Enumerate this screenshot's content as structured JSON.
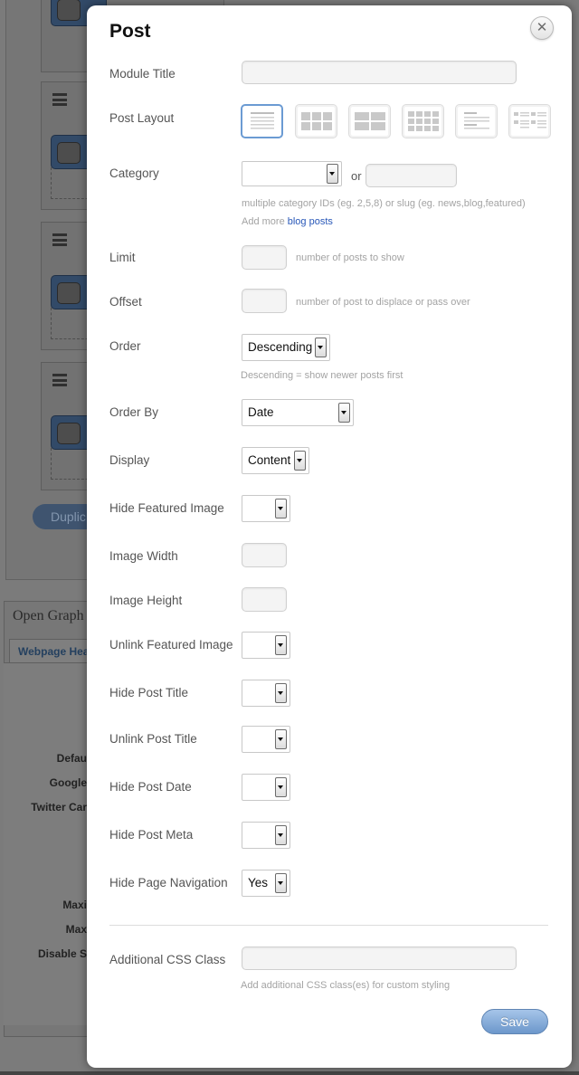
{
  "background": {
    "og_title": "Open Graph",
    "og_tab": "Webpage Hea",
    "duplicate_label": "Duplic",
    "labels": [
      "Defau",
      "Google",
      "Twitter Car",
      "Maxi",
      "Max",
      "Disable S"
    ]
  },
  "modal": {
    "title": "Post",
    "close_glyph": "✕",
    "fields": {
      "module_title": {
        "label": "Module Title",
        "value": ""
      },
      "post_layout": {
        "label": "Post Layout",
        "options": [
          "list-post",
          "grid4",
          "grid2",
          "grid3",
          "list-thumb-image",
          "grid2-thumb"
        ],
        "selected": "list-post"
      },
      "category": {
        "label": "Category",
        "value": "",
        "or_label": "or",
        "slug_value": "",
        "help": "multiple category IDs (eg. 2,5,8) or slug (eg. news,blog,featured)",
        "add_more_prefix": "Add more ",
        "add_more_link": "blog posts"
      },
      "limit": {
        "label": "Limit",
        "value": "",
        "help": "number of posts to show"
      },
      "offset": {
        "label": "Offset",
        "value": "",
        "help": "number of post to displace or pass over"
      },
      "order": {
        "label": "Order",
        "value": "Descending",
        "help": "Descending = show newer posts first"
      },
      "order_by": {
        "label": "Order By",
        "value": "Date"
      },
      "display": {
        "label": "Display",
        "value": "Content"
      },
      "hide_featured_image": {
        "label": "Hide Featured Image",
        "value": ""
      },
      "image_width": {
        "label": "Image Width",
        "value": ""
      },
      "image_height": {
        "label": "Image Height",
        "value": ""
      },
      "unlink_featured_image": {
        "label": "Unlink Featured Image",
        "value": ""
      },
      "hide_post_title": {
        "label": "Hide Post Title",
        "value": ""
      },
      "unlink_post_title": {
        "label": "Unlink Post Title",
        "value": ""
      },
      "hide_post_date": {
        "label": "Hide Post Date",
        "value": ""
      },
      "hide_post_meta": {
        "label": "Hide Post Meta",
        "value": ""
      },
      "hide_page_navigation": {
        "label": "Hide Page Navigation",
        "value": "Yes"
      },
      "css_class": {
        "label": "Additional CSS Class",
        "value": "",
        "help": "Add additional CSS class(es) for custom styling"
      }
    },
    "save_label": "Save"
  }
}
